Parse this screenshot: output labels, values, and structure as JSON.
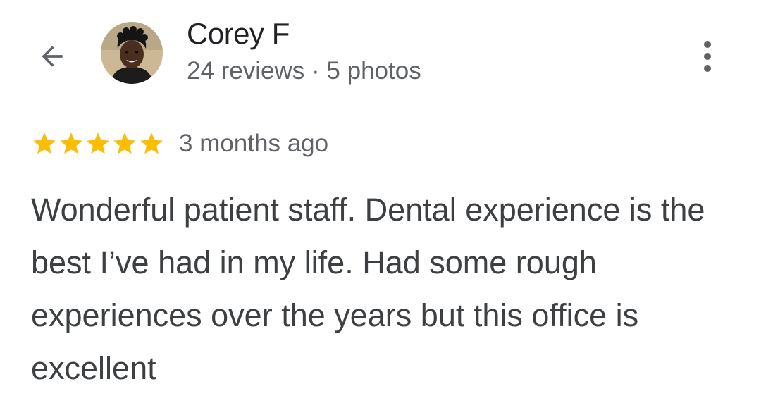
{
  "header": {
    "back_icon": "arrow-back-icon",
    "avatar_icon": "avatar",
    "author_name": "Corey F",
    "reviews_count": "24 reviews",
    "separator": "·",
    "photos_count": "5 photos",
    "more_icon": "more-vertical-icon"
  },
  "review": {
    "rating": 5,
    "rating_max": 5,
    "star_color": "#fbbc04",
    "time": "3 months ago",
    "text": "Wonderful patient staff. Dental experience is the best I’ve had in my life. Had some rough experiences over the years but this office is excellent"
  }
}
